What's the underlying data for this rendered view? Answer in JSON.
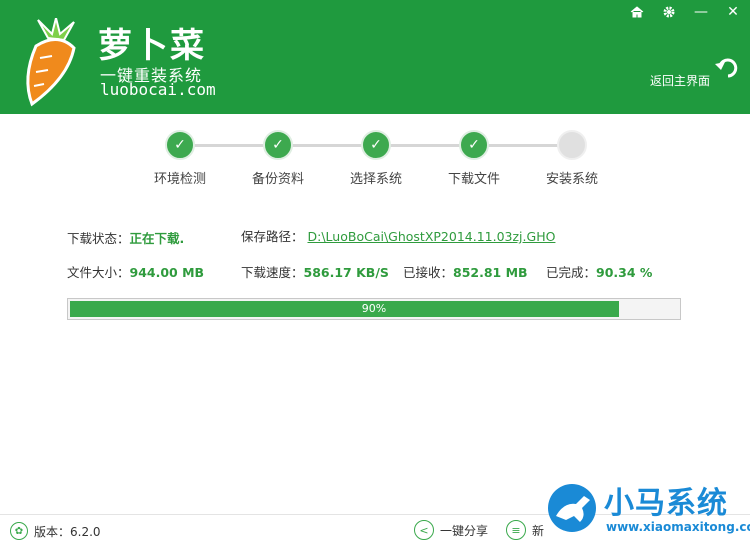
{
  "brand": {
    "title": "萝卜菜",
    "subtitle": "一键重装系统",
    "url": "luobocai.com"
  },
  "window_controls": {
    "home_icon": "home-icon",
    "settings_icon": "gear-icon",
    "minimize": "—",
    "close": "✕"
  },
  "header": {
    "back_label": "返回主界面"
  },
  "steps": [
    {
      "label": "环境检测",
      "status": "done"
    },
    {
      "label": "备份资料",
      "status": "done"
    },
    {
      "label": "选择系统",
      "status": "done"
    },
    {
      "label": "下载文件",
      "status": "done"
    },
    {
      "label": "安装系统",
      "status": "pending"
    }
  ],
  "download": {
    "status_key": "下载状态：",
    "status_value": "正在下载.",
    "path_key": "保存路径：",
    "path_value": "D:\\LuoBoCai\\GhostXP2014.11.03zj.GHO",
    "size_key": "文件大小：",
    "size_value": "944.00 MB",
    "speed_key": "下载速度：",
    "speed_value": "586.17 KB/S",
    "received_key": "已接收：",
    "received_value": "852.81 MB",
    "done_key": "已完成：",
    "done_value": "90.34 %"
  },
  "progress": {
    "label": "90%",
    "fraction": 0.9034
  },
  "footer": {
    "version": "版本：6.2.0",
    "share": "一键分享",
    "news_partial": "新"
  },
  "watermark": {
    "title": "小马系统",
    "url": "www.xiaomaxitong.com"
  },
  "colors": {
    "header_green": "#1f9a3e",
    "accent_green": "#3aa94c",
    "watermark_blue": "#1a8ad6"
  }
}
